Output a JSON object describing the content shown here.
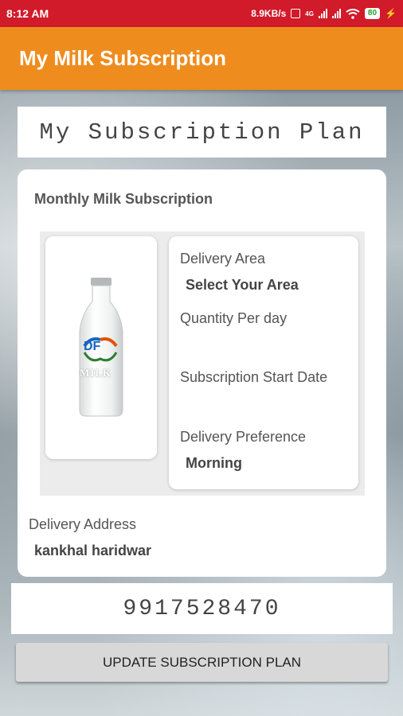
{
  "status_bar": {
    "time": "8:12 AM",
    "network_speed": "8.9KB/s",
    "network_type": "4G",
    "battery": "80"
  },
  "app_bar": {
    "title": "My Milk Subscription"
  },
  "plan_header": {
    "title": "My Subscription Plan"
  },
  "card": {
    "title": "Monthly Milk Subscription",
    "product_image": {
      "logo_text": "DF",
      "label": "MILK",
      "icon": "milk-bottle-icon"
    },
    "fields": {
      "delivery_area_label": "Delivery Area",
      "delivery_area_value": "Select Your Area",
      "quantity_label": "Quantity Per day",
      "quantity_value": "",
      "start_date_label": "Subscription Start Date",
      "start_date_value": "",
      "preference_label": "Delivery Preference",
      "preference_value": "Morning"
    },
    "address_label": "Delivery Address",
    "address_value": "kankhal haridwar"
  },
  "phone": {
    "value": "9917528470"
  },
  "actions": {
    "update_label": "UPDATE SUBSCRIPTION PLAN"
  },
  "colors": {
    "status_bar": "#d11a2a",
    "app_bar": "#ee8c1e",
    "card_bg": "#ffffff",
    "button_bg": "#d8d8d8"
  }
}
